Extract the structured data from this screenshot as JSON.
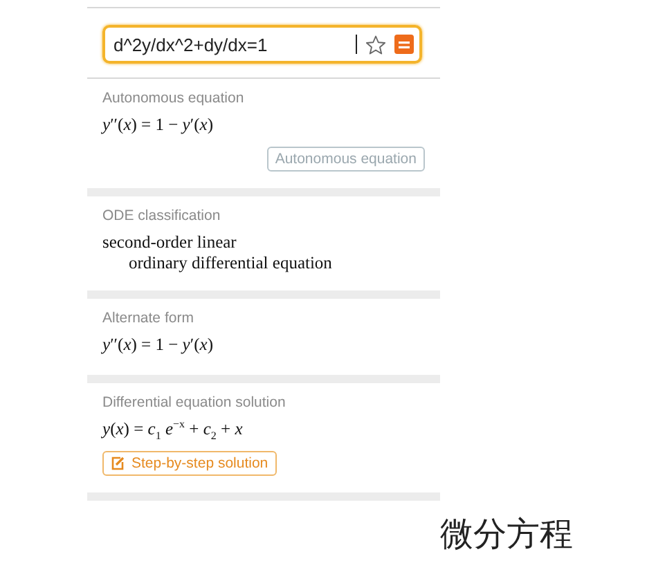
{
  "query": {
    "value": "d^2y/dx^2+dy/dx=1",
    "favorited": false
  },
  "pods": [
    {
      "title": "Autonomous equation",
      "kind": "math",
      "lines": [
        "*y*′′(*x*) = 1 − *y*′(*x*)"
      ],
      "button": {
        "kind": "plain",
        "label": "Autonomous equation"
      }
    },
    {
      "title": "ODE classification",
      "kind": "text",
      "lines": [
        "second-order linear",
        "ordinary differential equation"
      ]
    },
    {
      "title": "Alternate form",
      "kind": "math",
      "lines": [
        "*y*′′(*x*) = 1 − *y*′(*x*)"
      ]
    },
    {
      "title": "Differential equation solution",
      "kind": "math",
      "lines": [
        "*y*(*x*) = *c*$_{1}$ *e*$^{−x}$ + *c*$_{2}$ + *x*"
      ],
      "button": {
        "kind": "step",
        "label": "Step-by-step solution"
      }
    }
  ],
  "caption": "微分方程"
}
